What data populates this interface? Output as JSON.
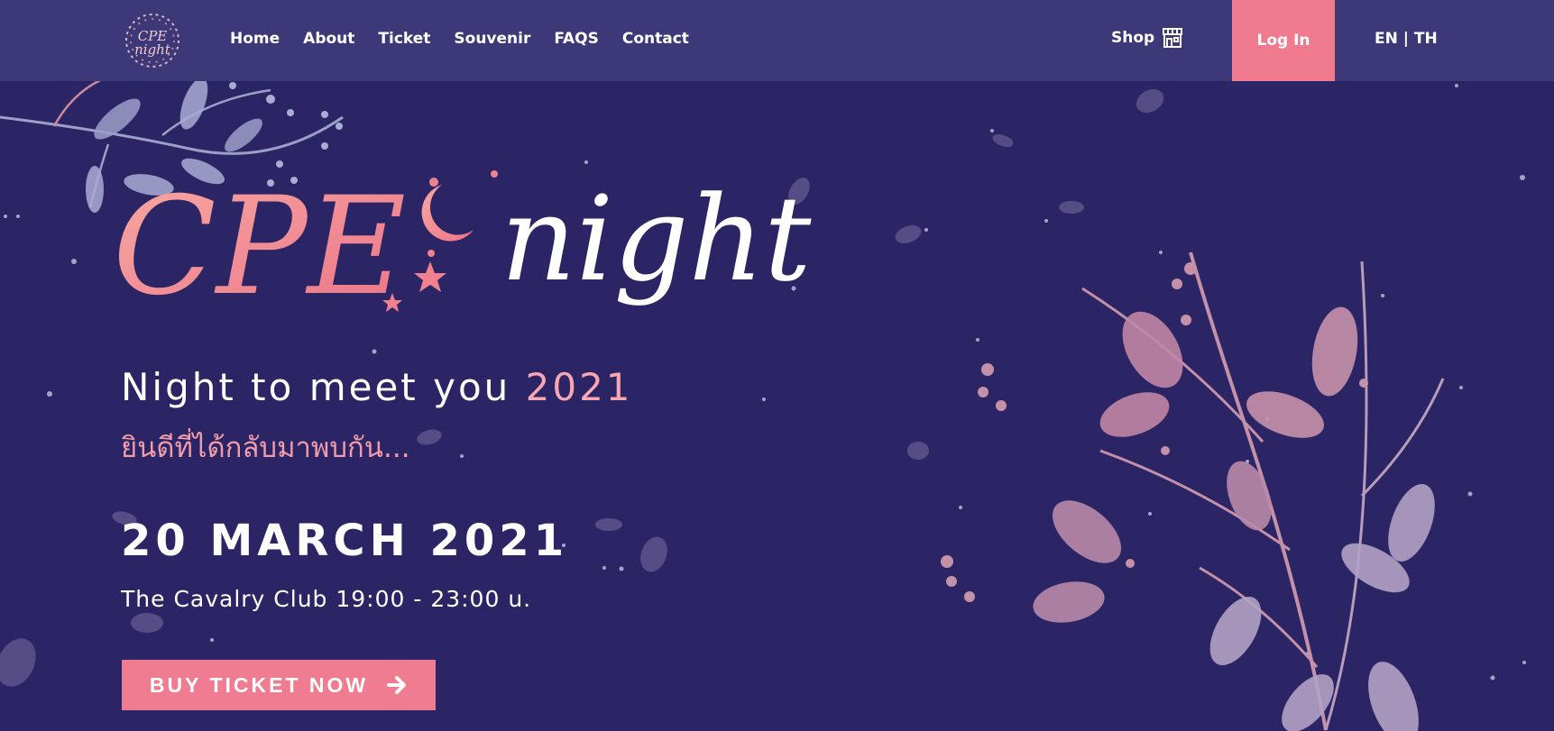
{
  "header": {
    "logo_text": "CPE night",
    "nav": [
      "Home",
      "About",
      "Ticket",
      "Souvenir",
      "FAQS",
      "Contact"
    ],
    "shop_label": "Shop",
    "login_label": "Log In",
    "language": {
      "en": "EN",
      "separator": "|",
      "th": "TH"
    }
  },
  "hero": {
    "logo_left": "CPE",
    "logo_right": "night",
    "tagline": "Night to meet you",
    "tagline_year": "2021",
    "thai_greeting": "ยินดีที่ได้กลับมาพบกัน...",
    "date": "20 MARCH 2021",
    "venue": "The Cavalry Club 19:00 - 23:00 u.",
    "cta_label": "BUY TICKET NOW"
  },
  "icons": [
    "shop-icon",
    "arrow-right-icon"
  ],
  "colors": {
    "background": "#2b2566",
    "header": "#3d3877",
    "accent": "#f07a8e",
    "accent_light": "#f6a7b2"
  }
}
